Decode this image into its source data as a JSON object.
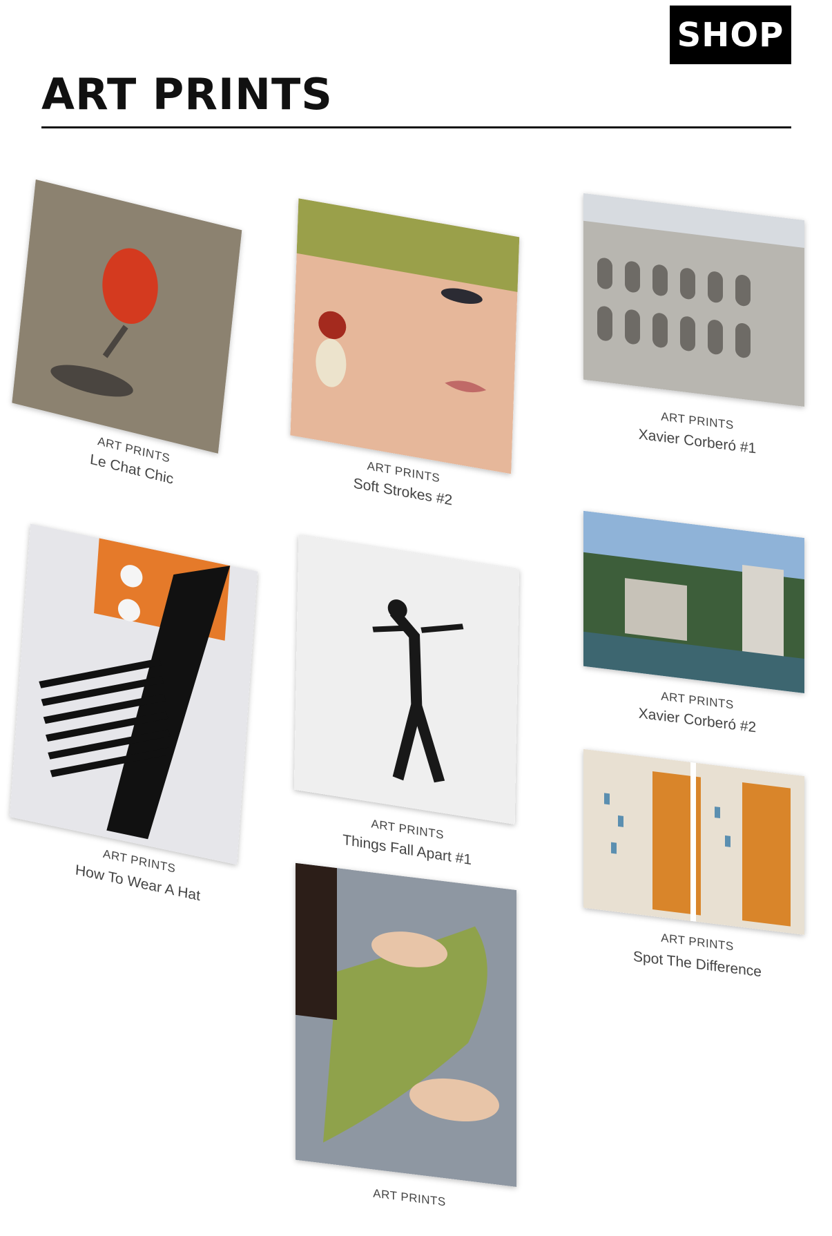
{
  "header": {
    "shop_label": "SHOP",
    "page_title": "ART PRINTS"
  },
  "products": [
    {
      "category": "ART PRINTS",
      "name": "Le Chat Chic"
    },
    {
      "category": "ART PRINTS",
      "name": "Soft Strokes #2"
    },
    {
      "category": "ART PRINTS",
      "name": "Xavier Corberó #1"
    },
    {
      "category": "ART PRINTS",
      "name": "How To Wear A Hat"
    },
    {
      "category": "ART PRINTS",
      "name": "Things Fall Apart #1"
    },
    {
      "category": "ART PRINTS",
      "name": "Xavier Corberó #2"
    },
    {
      "category": "ART PRINTS",
      "name": "Spot The Difference"
    },
    {
      "category": "ART PRINTS",
      "name": ""
    }
  ],
  "colors": {
    "button_bg": "#000000",
    "button_text": "#ffffff",
    "rule": "#111111"
  }
}
